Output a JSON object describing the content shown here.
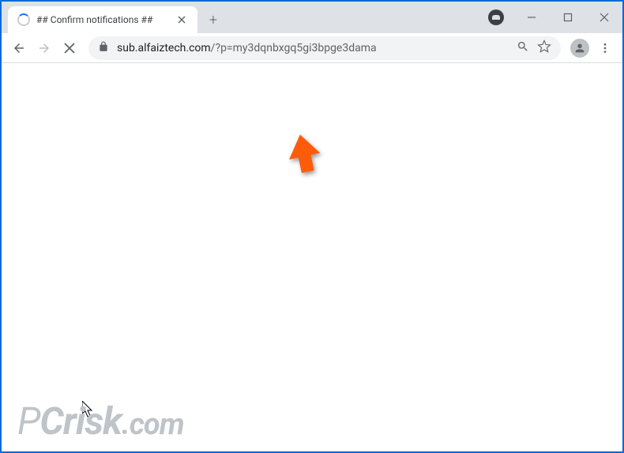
{
  "tab": {
    "title": "## Confirm notifications ##"
  },
  "url": {
    "domain": "sub.alfaiztech.com",
    "path": "/?p=my3dqnbxgq5gi3bpge3dama"
  },
  "watermark": {
    "text_prefix": "P",
    "text_main": "Crisk",
    "text_suffix": ".com"
  }
}
